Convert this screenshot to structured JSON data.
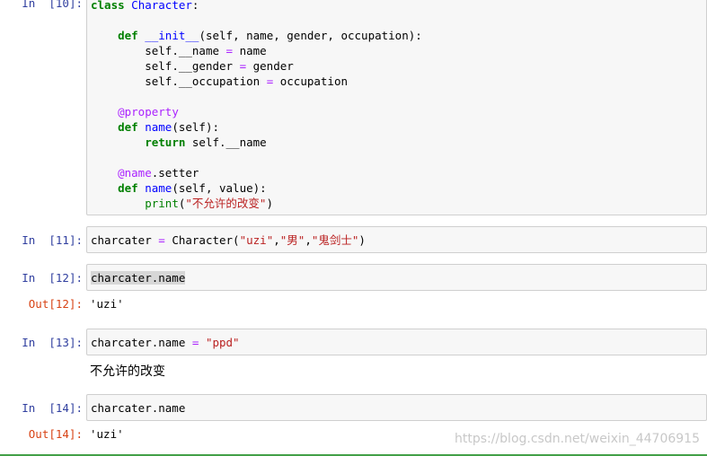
{
  "cells": [
    {
      "prompt": "In  [10]:",
      "type": "input"
    },
    {
      "prompt": "In  [11]:",
      "type": "input"
    },
    {
      "prompt": "In  [12]:",
      "type": "input",
      "out_prompt": "Out[12]:",
      "output": "'uzi'"
    },
    {
      "prompt": "In  [13]:",
      "type": "input",
      "stdout": "不允许的改变"
    },
    {
      "prompt": "In  [14]:",
      "type": "input",
      "out_prompt": "Out[14]:",
      "output": "'uzi'"
    }
  ],
  "code": {
    "c10": {
      "l1_kw": "class",
      "l1_name": "Character",
      "l1_rest": ":",
      "l3_kw": "def",
      "l3_name": "__init__",
      "l3_rest": "(self, name, gender, occupation):",
      "l4a": "self.__name ",
      "l4op": "=",
      "l4b": " name",
      "l5a": "self.__gender ",
      "l5op": "=",
      "l5b": " gender",
      "l6a": "self.__occupation ",
      "l6op": "=",
      "l6b": " occupation",
      "l8": "@property",
      "l9_kw": "def",
      "l9_name": "name",
      "l9_rest": "(self):",
      "l10_kw": "return",
      "l10_rest": " self.__name",
      "l12_dec": "@name",
      "l12_rest": ".setter",
      "l13_kw": "def",
      "l13_name": "name",
      "l13_rest": "(self, value):",
      "l14_bi": "print",
      "l14_p1": "(",
      "l14_str": "\"不允许的改变\"",
      "l14_p2": ")"
    },
    "c11": {
      "a": "charcater ",
      "op": "=",
      "b": " Character(",
      "s1": "\"uzi\"",
      "c1": ",",
      "s2": "\"男\"",
      "c2": ",",
      "s3": "\"鬼剑士\"",
      "end": ")"
    },
    "c12": {
      "text": "charcater.name"
    },
    "c13": {
      "a": "charcater.name ",
      "op": "=",
      "b": " ",
      "s": "\"ppd\""
    },
    "c14": {
      "text": "charcater.name"
    }
  },
  "watermark": "https://blog.csdn.net/weixin_44706915",
  "colors": {
    "in_prompt": "#303f9f",
    "out_prompt": "#d84315",
    "keyword": "#008000",
    "string": "#ba2121",
    "operator": "#aa22ff"
  }
}
